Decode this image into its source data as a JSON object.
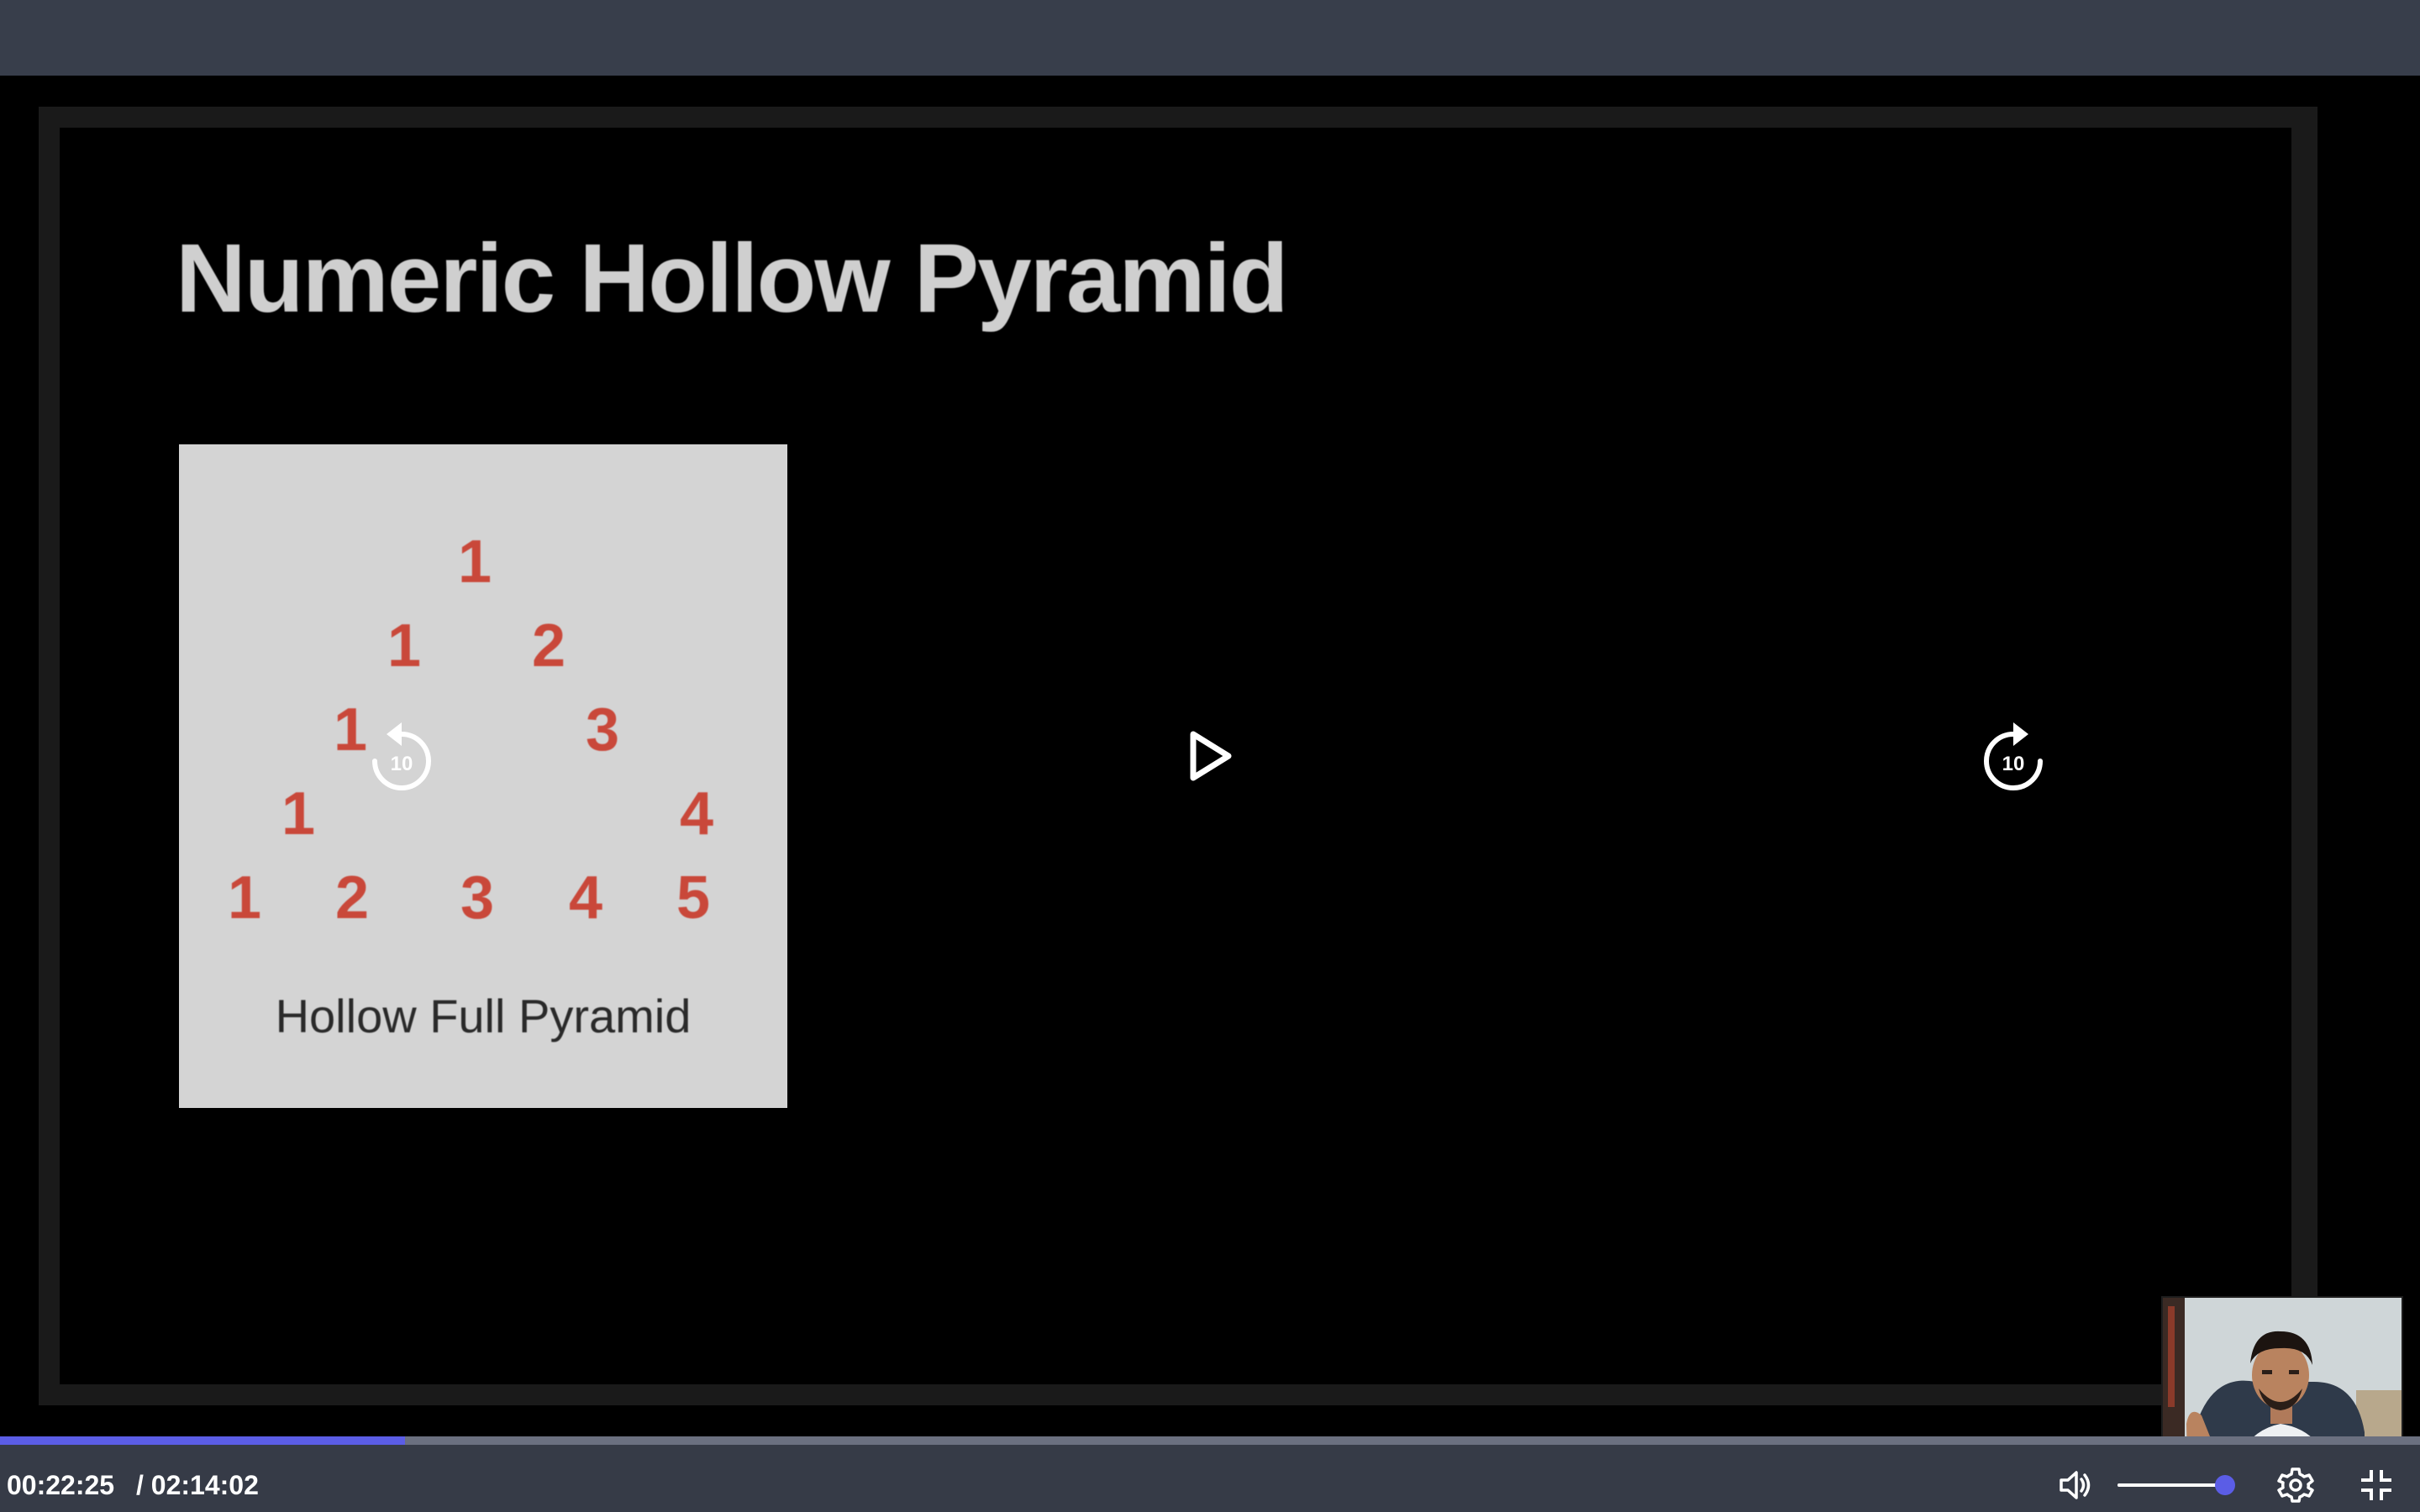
{
  "slide": {
    "title": "Numeric Hollow Pyramid",
    "pyramid_rows": [
      [
        "1"
      ],
      [
        "1",
        "2"
      ],
      [
        "1",
        "3"
      ],
      [
        "1",
        "4"
      ],
      [
        "1",
        "2",
        "3",
        "4",
        "5"
      ]
    ],
    "caption": "Hollow Full Pyramid"
  },
  "overlay": {
    "rewind_icon": "rewind-10-icon",
    "rewind_seconds": "10",
    "play_icon": "play-icon",
    "forward_icon": "forward-10-icon",
    "forward_seconds": "10"
  },
  "player": {
    "current_time": "00:22:25",
    "duration": "/ 02:14:02",
    "progress": 0.1672,
    "volume": 0.95,
    "icons": {
      "volume": "volume-icon",
      "settings": "gear-icon",
      "exit_fullscreen": "exit-fullscreen-icon"
    }
  },
  "colors": {
    "accent": "#5b5de6",
    "controls_bg": "#363b47",
    "top_bar_bg": "#383e4b",
    "pyramid_digit": "#c9483a",
    "card_bg": "#d4d4d4"
  }
}
